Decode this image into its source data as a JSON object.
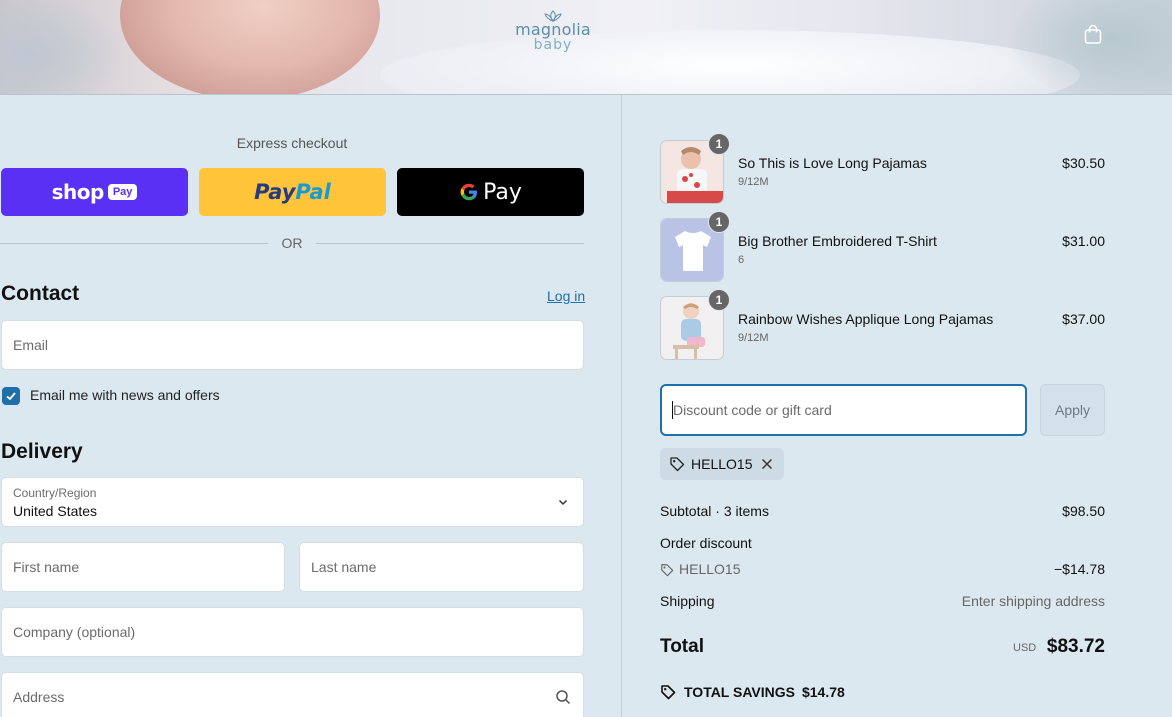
{
  "brand": {
    "logo_line1": "magnolia",
    "logo_line2": "baby"
  },
  "colors": {
    "accent": "#1f6fa8",
    "shop_pay": "#5a31f4",
    "paypal": "#ffc439",
    "gpay": "#000000",
    "background": "#dce8f0"
  },
  "express": {
    "title": "Express checkout",
    "shop_pay": {
      "word": "shop",
      "chip": "Pay"
    },
    "paypal": {
      "part1": "Pay",
      "part2": "Pal"
    },
    "gpay": {
      "g": "G",
      "pay": "Pay"
    },
    "or": "OR"
  },
  "contact": {
    "title": "Contact",
    "login": "Log in",
    "email_placeholder": "Email",
    "newsletter_label": "Email me with news and offers",
    "newsletter_checked": true
  },
  "delivery": {
    "title": "Delivery",
    "country_label": "Country/Region",
    "country_value": "United States",
    "first_name_placeholder": "First name",
    "last_name_placeholder": "Last name",
    "company_placeholder": "Company (optional)",
    "address_placeholder": "Address"
  },
  "cart": {
    "items": [
      {
        "name": "So This is Love Long Pajamas",
        "variant": "9/12M",
        "price": "$30.50",
        "qty": "1"
      },
      {
        "name": "Big Brother Embroidered T-Shirt",
        "variant": "6",
        "price": "$31.00",
        "qty": "1"
      },
      {
        "name": "Rainbow Wishes Applique Long Pajamas",
        "variant": "9/12M",
        "price": "$37.00",
        "qty": "1"
      }
    ]
  },
  "discount": {
    "placeholder": "Discount code or gift card",
    "apply": "Apply",
    "applied_code": "HELLO15"
  },
  "summary": {
    "subtotal_label": "Subtotal · 3 items",
    "subtotal_value": "$98.50",
    "order_discount_label": "Order discount",
    "discount_code": "HELLO15",
    "discount_value": "−$14.78",
    "shipping_label": "Shipping",
    "shipping_value": "Enter shipping address",
    "total_label": "Total",
    "currency": "USD",
    "total_value": "$83.72",
    "savings_label": "TOTAL SAVINGS",
    "savings_value": "$14.78"
  }
}
